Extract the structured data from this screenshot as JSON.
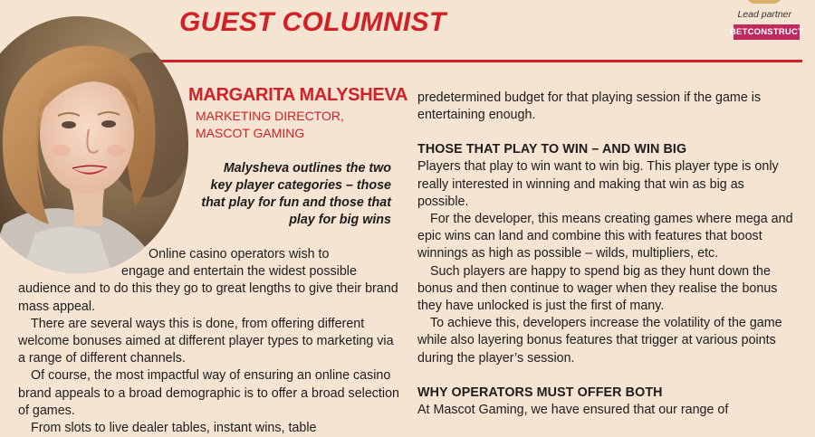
{
  "header": {
    "title": "GUEST COLUMNIST",
    "partner_label": "Lead partner",
    "partner_logo_text": "BETCONSTRUCT"
  },
  "author": {
    "name": "MARGARITA MALYSHEVA",
    "role_line1": "MARKETING DIRECTOR,",
    "role_line2": "MASCOT GAMING"
  },
  "standfirst": {
    "line1": "Malysheva outlines the two",
    "line2": "key player categories – those",
    "line3": "that play for fun and those that",
    "line4": "play for big wins"
  },
  "left_column": {
    "lead_line1": "Online casino operators wish to",
    "lead_line2": "engage and entertain the widest possible",
    "lead_rest": "audience and to do this they go to great lengths to give their brand mass appeal.",
    "p2": "There are several ways this is done, from offering different welcome bonuses aimed at different player types to marketing via a range of different channels.",
    "p3": "Of course, the most impactful way of ensuring an online casino brand appeals to a broad demographic is to offer a broad selection of games.",
    "p4_partial": "From slots to live dealer tables, instant wins, table"
  },
  "right_column": {
    "cont": "predetermined budget for that playing session if the game is entertaining enough.",
    "subhead1": "THOSE THAT PLAY TO WIN – AND WIN BIG",
    "p1": "Players that play to win want to win big. This player type is only really interested in winning and making that win as big as possible.",
    "p2": "For the developer, this means creating games where mega and epic wins can land and combine this with features that boost winnings as high as possible – wilds, multipliers, etc.",
    "p3": "Such players are happy to spend big as they hunt down the bonus and then continue to wager when they realise the bonus they have unlocked is just the first of many.",
    "p4": "To achieve this, developers increase the volatility of the game while also layering bonus features that trigger at various points during the player’s session.",
    "subhead2": "WHY OPERATORS MUST OFFER BOTH",
    "p5_partial": "At Mascot Gaming, we have ensured that our range of"
  },
  "colors": {
    "accent": "#d32027",
    "background": "#f5e4d2",
    "partner_logo": "#c0295e"
  },
  "icons": {
    "portrait": "author-portrait-photo"
  }
}
